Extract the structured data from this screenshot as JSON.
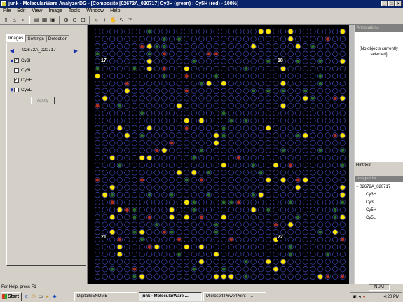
{
  "window": {
    "title": "junk - MolecularWare AnalyzerDG - [Composite [02672A_020717] Cy3H (green) : Cy5H (red) - 100%]",
    "controls": [
      "_",
      "□",
      "×"
    ]
  },
  "menu": [
    "File",
    "Edit",
    "View",
    "Image",
    "Tools",
    "Window",
    "Help"
  ],
  "toolbar_icons": [
    "new-icon",
    "open-icon",
    "save-icon",
    "film-icon",
    "export-icon",
    "image-icon",
    "zoom-in-icon",
    "zoom-out-icon",
    "zoom-fit-icon",
    "crosshair-icon",
    "search-icon",
    "hand-icon",
    "select-icon",
    "help-icon"
  ],
  "left_panel": {
    "tabs": [
      "Images",
      "Settings",
      "Detection"
    ],
    "dataset": "02672A_020717",
    "channels": [
      {
        "label": "Cy3H",
        "checked": true,
        "arrow": "up"
      },
      {
        "label": "Cy3L",
        "checked": false,
        "arrow": ""
      },
      {
        "label": "Cy5H",
        "checked": true,
        "arrow": ""
      },
      {
        "label": "Cy5L",
        "checked": false,
        "arrow": "down"
      }
    ],
    "apply_label": "Apply"
  },
  "image": {
    "block_labels": [
      "17",
      "18",
      "21",
      "22"
    ]
  },
  "right_panel": {
    "annotations_title": "Annotations",
    "annotations_empty": "[No objects currently selected]",
    "hint_text": "Hint text",
    "image_list_title": "Image List",
    "tree": {
      "root": "02672A_020717",
      "children": [
        "Cy3H",
        "Cy3L",
        "Cy5H",
        "Cy5L"
      ]
    }
  },
  "status": {
    "help_text": "For Help, press F1",
    "num": "NUM"
  },
  "taskbar": {
    "start": "Start",
    "items": [
      "DigitalGENOME",
      "junk - MolecularWare ...",
      "Microsoft PowerPoint - ..."
    ],
    "clock": "4:20 PM"
  },
  "colors": {
    "titlebar": "#0a246a",
    "spot_green": "#2a6a2a",
    "spot_yellow": "#ffe600",
    "spot_red": "#b03020",
    "grid_circle": "#3c46b4"
  }
}
